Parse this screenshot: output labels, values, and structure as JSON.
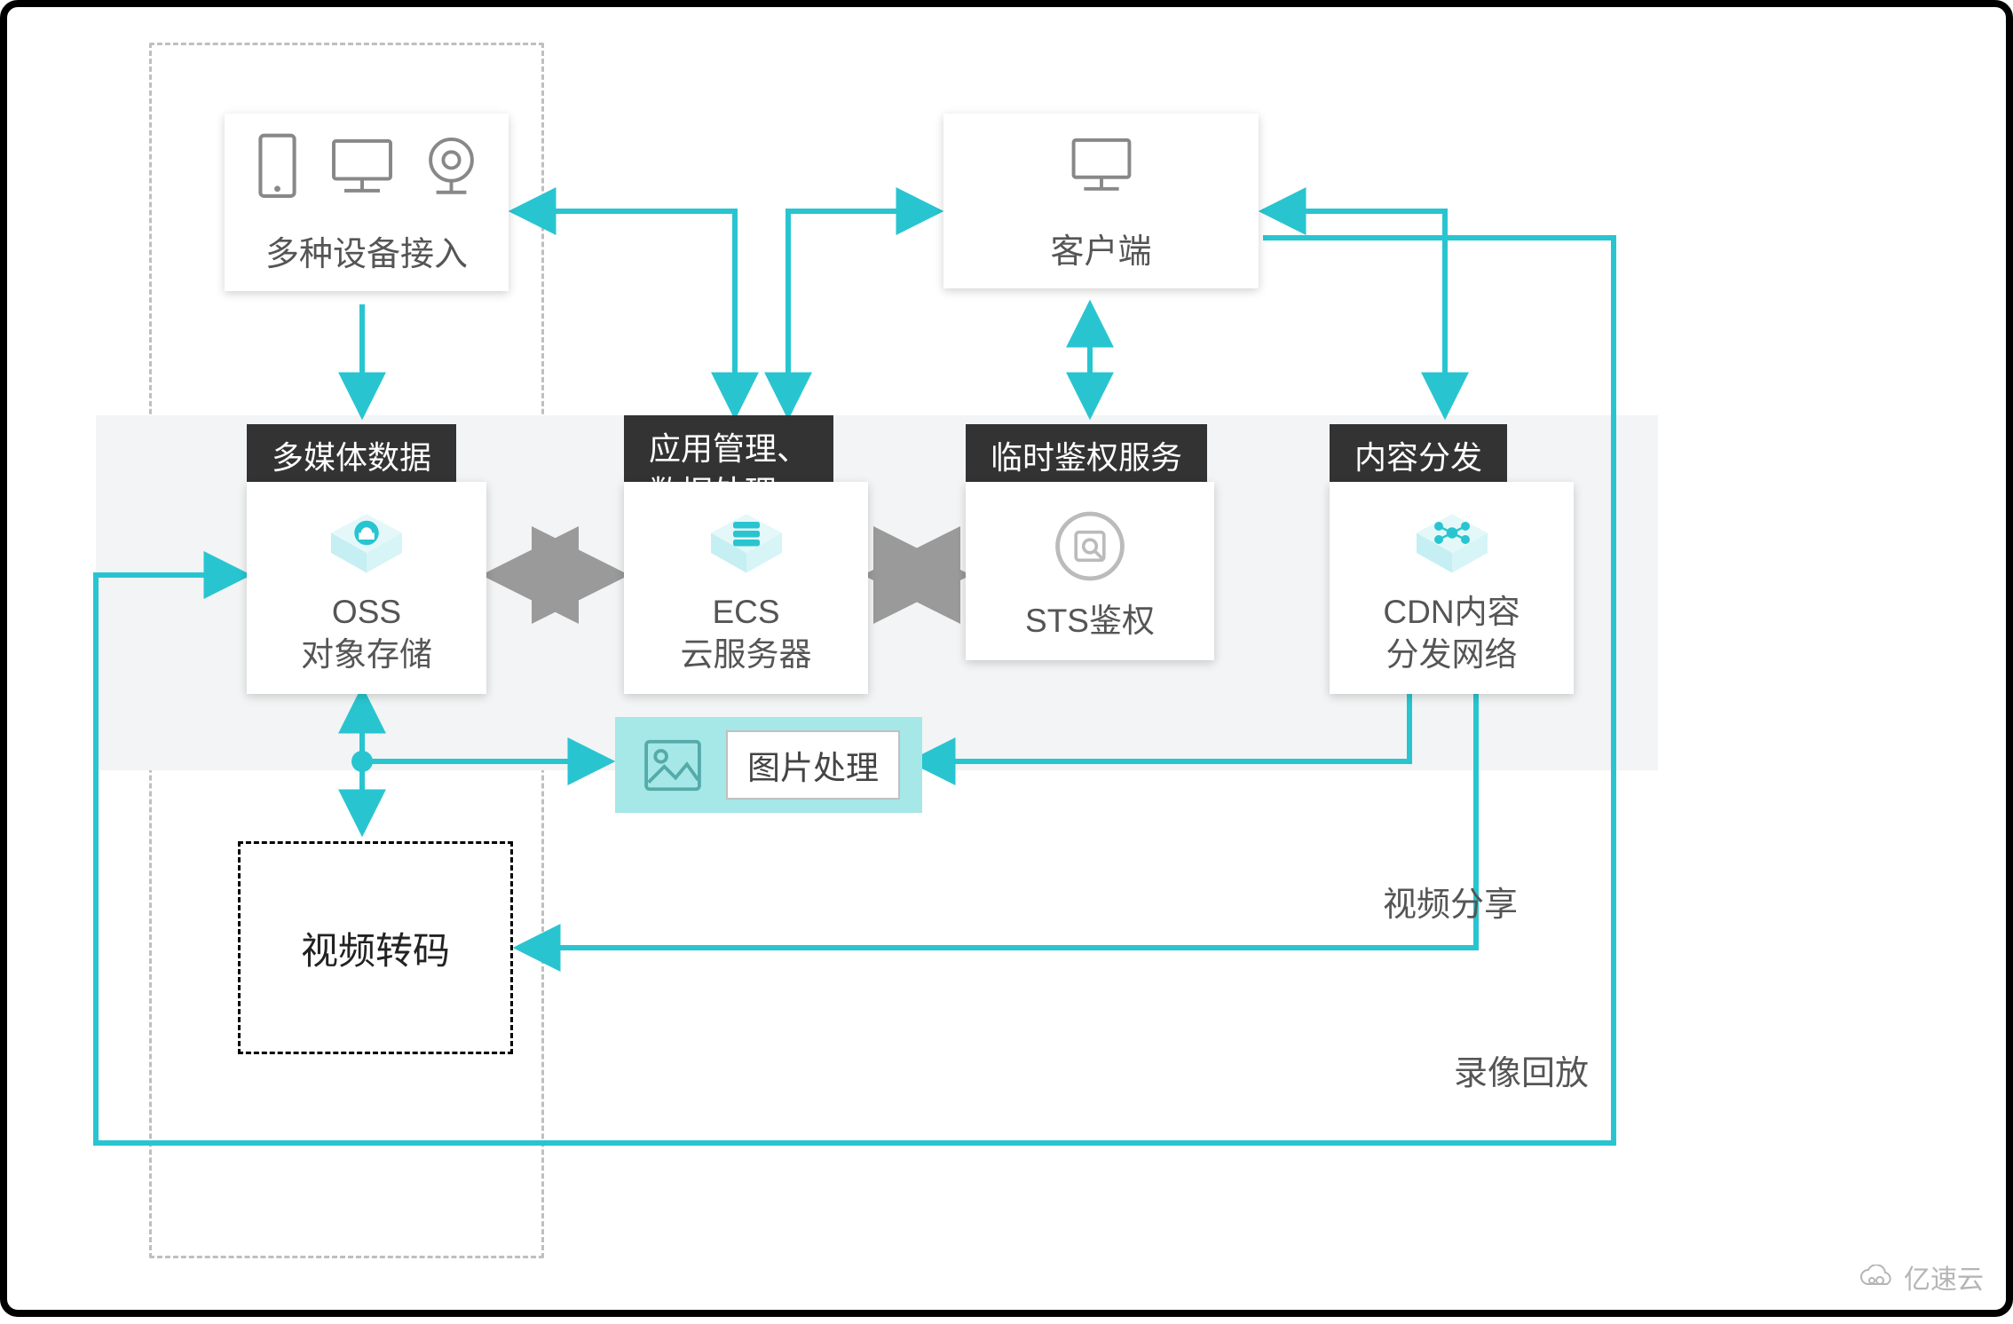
{
  "colors": {
    "cyan": "#28c5d0",
    "cyan_light": "#a6e7e7",
    "gray_arrow": "#9a9a9a",
    "dark_tab": "#333333",
    "text": "#555555"
  },
  "devices": {
    "label": "多种设备接入"
  },
  "client": {
    "label": "客户端"
  },
  "services": {
    "oss": {
      "tab": "多媒体数据",
      "title": "OSS",
      "subtitle": "对象存储"
    },
    "ecs": {
      "tab": "应用管理、\n数据处理",
      "title": "ECS",
      "subtitle": "云服务器"
    },
    "sts": {
      "tab": "临时鉴权服务",
      "title": "STS鉴权"
    },
    "cdn": {
      "tab": "内容分发",
      "title": "CDN内容",
      "subtitle": "分发网络"
    }
  },
  "img_proc": {
    "label": "图片处理"
  },
  "video_transcode": {
    "label": "视频转码"
  },
  "notes": {
    "video_share": "视频分享",
    "record_replay": "录像回放"
  },
  "watermark": "亿速云"
}
